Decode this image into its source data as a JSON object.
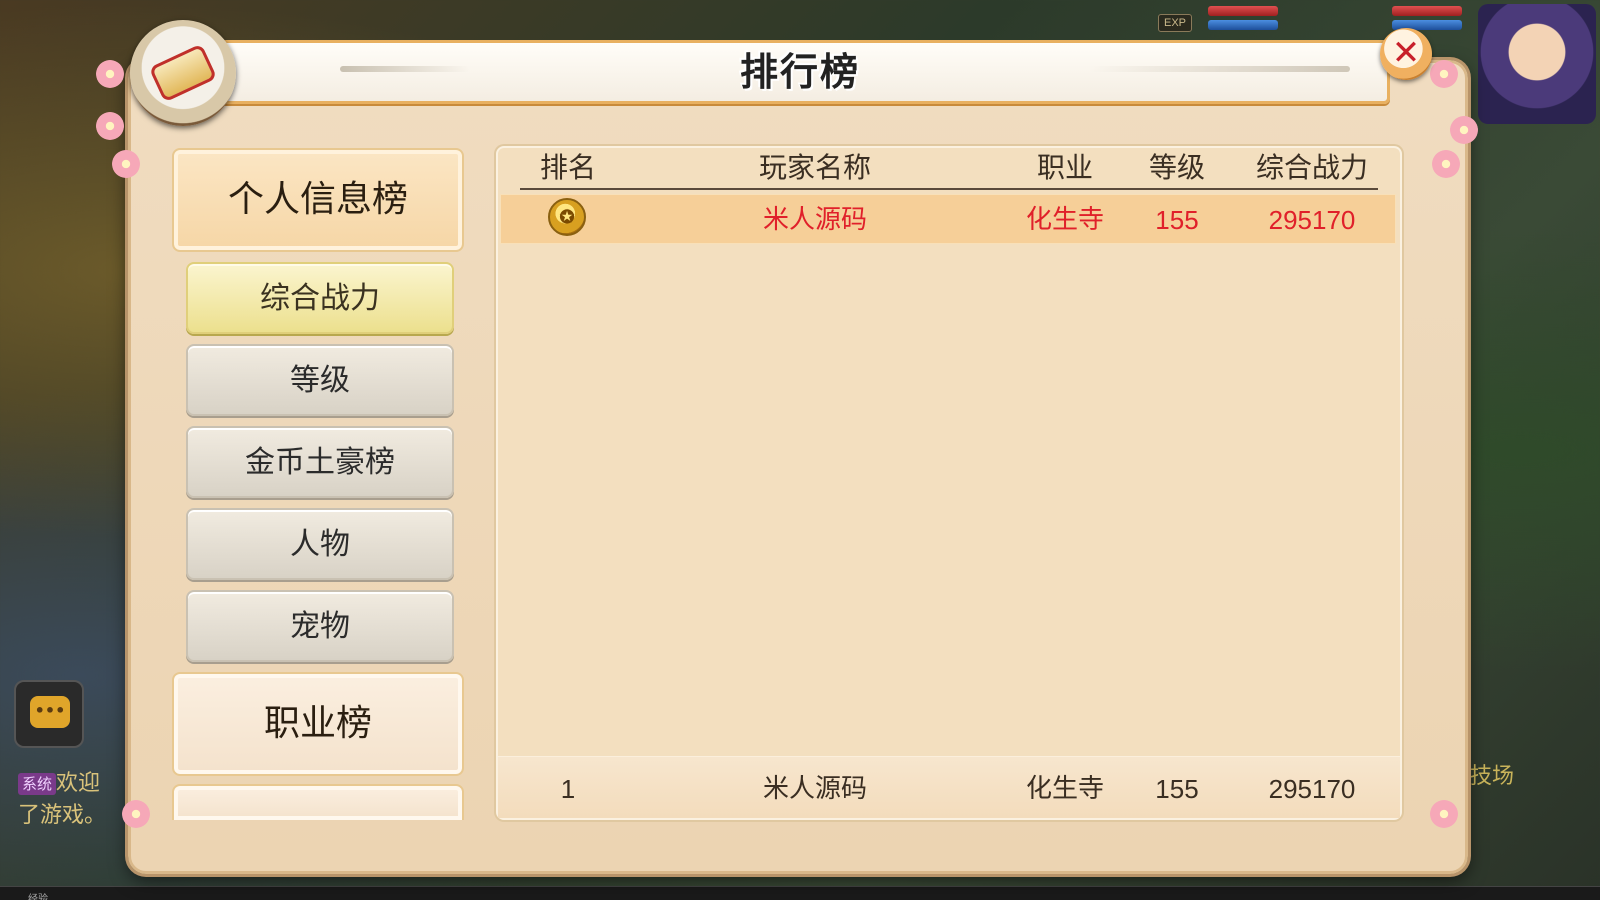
{
  "window": {
    "title": "排行榜",
    "close_icon": "close-icon",
    "badge_icon": "scroll-icon"
  },
  "background": {
    "exp_label": "EXP",
    "chat_sys_tag": "系统",
    "chat_line1": "欢迎",
    "chat_line2": "了游戏。",
    "side_text": "技场",
    "bottom_label": "经验"
  },
  "nav": {
    "sections": [
      {
        "label": "个人信息榜",
        "active": true,
        "items": [
          {
            "label": "综合战力",
            "selected": true
          },
          {
            "label": "等级",
            "selected": false
          },
          {
            "label": "金币土豪榜",
            "selected": false
          },
          {
            "label": "人物",
            "selected": false
          },
          {
            "label": "宠物",
            "selected": false
          }
        ]
      },
      {
        "label": "职业榜",
        "active": false,
        "items": []
      }
    ]
  },
  "table": {
    "columns": [
      "排名",
      "玩家名称",
      "职业",
      "等级",
      "综合战力"
    ],
    "rows": [
      {
        "rank_icon": "gold-medal-icon",
        "name": "米人源码",
        "class": "化生寺",
        "level": "155",
        "power": "295170"
      }
    ],
    "self_row": {
      "rank": "1",
      "name": "米人源码",
      "class": "化生寺",
      "level": "155",
      "power": "295170"
    }
  },
  "colors": {
    "highlight_text": "#e0202a",
    "selected_tab": "#ece08e",
    "panel_bg": "#f3dfbf"
  }
}
